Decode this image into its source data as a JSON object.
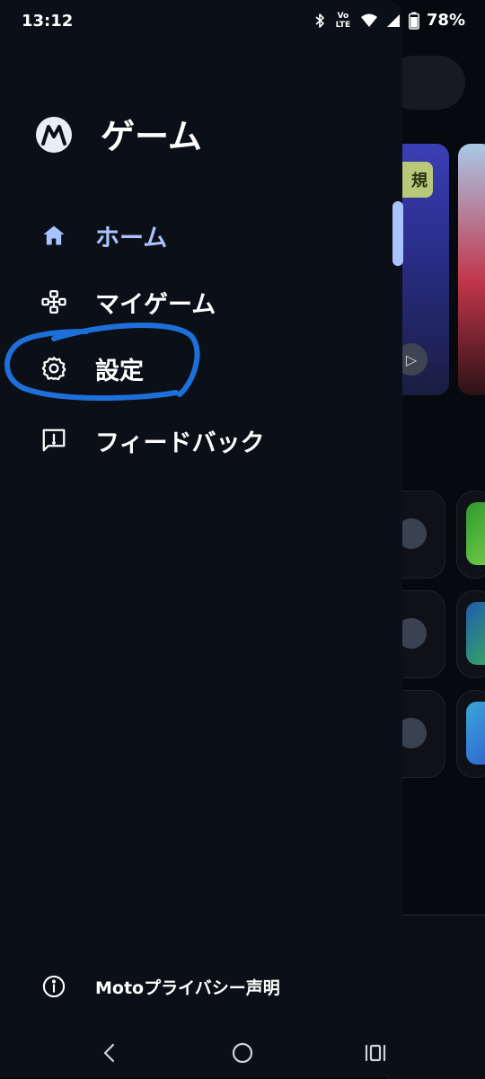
{
  "status_bar": {
    "time": "13:12",
    "volte": "Vo LTE",
    "battery": "78%"
  },
  "drawer": {
    "title": "ゲーム",
    "items": [
      {
        "label": "ホーム",
        "icon": "home-icon",
        "active": true
      },
      {
        "label": "マイゲーム",
        "icon": "gamepad-icon",
        "active": false
      },
      {
        "label": "設定",
        "icon": "gear-icon",
        "active": false
      },
      {
        "label": "フィードバック",
        "icon": "feedback-icon",
        "active": false
      }
    ],
    "footer": {
      "label": "Motoプライバシー声明",
      "icon": "info-icon"
    }
  },
  "background": {
    "badge": "規"
  },
  "colors": {
    "drawer_bg": "#0b0f17",
    "accent": "#a9c3ff",
    "annotation": "#1e6fd9"
  }
}
